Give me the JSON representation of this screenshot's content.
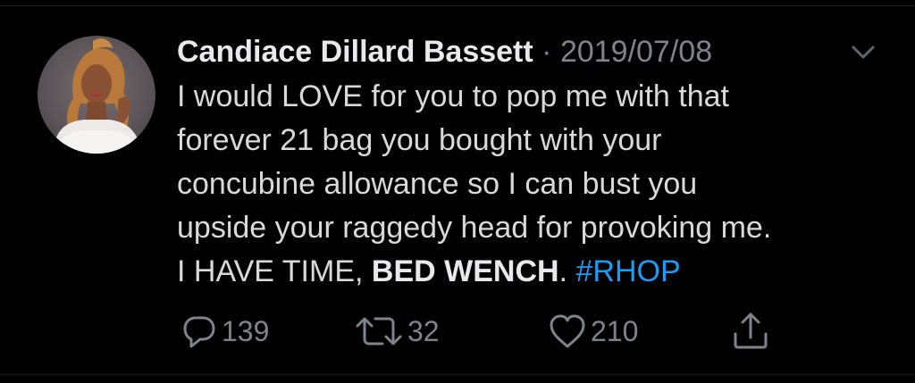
{
  "tweet": {
    "author_name": "Candiace Dillard Bassett",
    "separator": "·",
    "date": "2019/07/08",
    "text_lines": [
      "I would LOVE for you to pop me with that",
      "forever 21 bag you bought with your",
      "concubine allowance so I can bust you",
      "upside your raggedy head for provoking me."
    ],
    "text_last_prefix": "I HAVE TIME, ",
    "text_bold": "BED WENCH",
    "text_after_bold": ". ",
    "hashtag": "#RHOP"
  },
  "actions": {
    "replies": "139",
    "retweets": "32",
    "likes": "210"
  },
  "icons": {
    "avatar": "profile-photo",
    "menu": "chevron-down-icon",
    "reply": "reply-bubble-icon",
    "retweet": "retweet-arrows-icon",
    "like": "heart-icon",
    "share": "share-upload-icon"
  },
  "colors": {
    "background": "#000000",
    "name": "#e7e9ea",
    "body_text": "#d9d9d9",
    "muted": "#7d848b",
    "link": "#1d9bf0"
  }
}
